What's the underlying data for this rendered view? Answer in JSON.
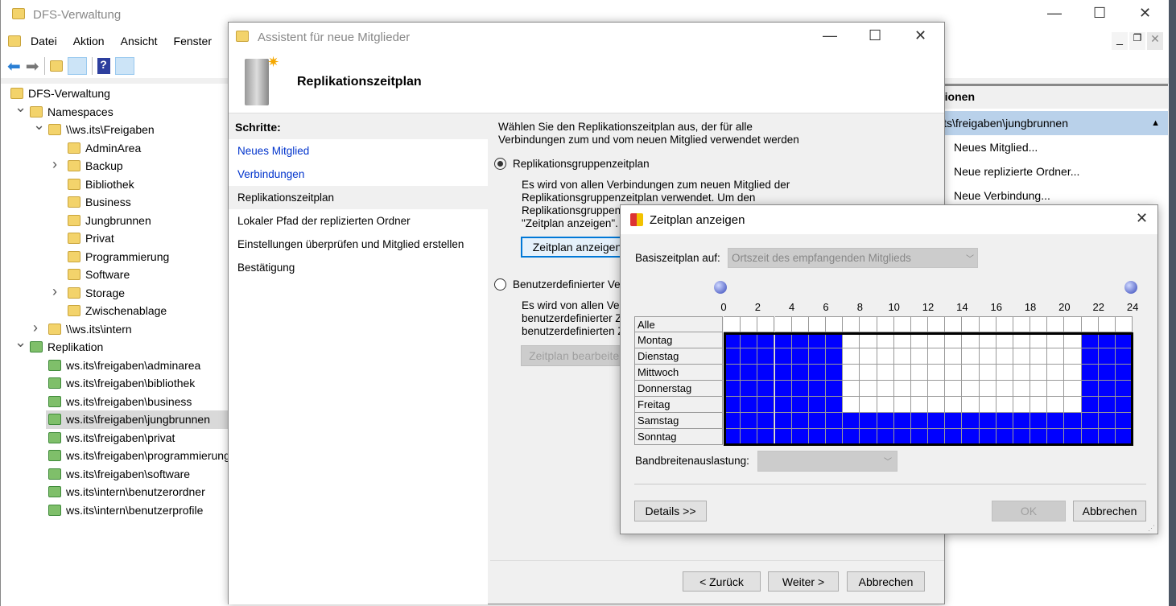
{
  "main_window": {
    "title": "DFS-Verwaltung",
    "menu": [
      "Datei",
      "Aktion",
      "Ansicht",
      "Fenster"
    ],
    "toolbar_icons": [
      "back-arrow-icon",
      "forward-arrow-icon",
      "up-folder-icon",
      "show-hide-tree-icon",
      "help-icon",
      "show-hide-action-icon"
    ]
  },
  "tree": [
    {
      "label": "DFS-Verwaltung",
      "level": 0,
      "icon": "dfs"
    },
    {
      "label": "Namespaces",
      "level": 1,
      "icon": "ns",
      "exp": "v"
    },
    {
      "label": "\\\\ws.its\\Freigaben",
      "level": 2,
      "icon": "ns",
      "exp": "v"
    },
    {
      "label": "AdminArea",
      "level": 3,
      "icon": "link"
    },
    {
      "label": "Backup",
      "level": 3,
      "icon": "folder",
      "exp": ">"
    },
    {
      "label": "Bibliothek",
      "level": 3,
      "icon": "link"
    },
    {
      "label": "Business",
      "level": 3,
      "icon": "link"
    },
    {
      "label": "Jungbrunnen",
      "level": 3,
      "icon": "link"
    },
    {
      "label": "Privat",
      "level": 3,
      "icon": "link"
    },
    {
      "label": "Programmierung",
      "level": 3,
      "icon": "link"
    },
    {
      "label": "Software",
      "level": 3,
      "icon": "link"
    },
    {
      "label": "Storage",
      "level": 3,
      "icon": "folder",
      "exp": ">"
    },
    {
      "label": "Zwischenablage",
      "level": 3,
      "icon": "link"
    },
    {
      "label": "\\\\ws.its\\intern",
      "level": 2,
      "icon": "ns",
      "exp": ">"
    },
    {
      "label": "Replikation",
      "level": 1,
      "icon": "rep",
      "exp": "v"
    },
    {
      "label": "ws.its\\freigaben\\adminarea",
      "level": 2,
      "icon": "rep"
    },
    {
      "label": "ws.its\\freigaben\\bibliothek",
      "level": 2,
      "icon": "rep"
    },
    {
      "label": "ws.its\\freigaben\\business",
      "level": 2,
      "icon": "rep"
    },
    {
      "label": "ws.its\\freigaben\\jungbrunnen",
      "level": 2,
      "icon": "rep",
      "selected": true
    },
    {
      "label": "ws.its\\freigaben\\privat",
      "level": 2,
      "icon": "rep"
    },
    {
      "label": "ws.its\\freigaben\\programmierung",
      "level": 2,
      "icon": "rep"
    },
    {
      "label": "ws.its\\freigaben\\software",
      "level": 2,
      "icon": "rep"
    },
    {
      "label": "ws.its\\intern\\benutzerordner",
      "level": 2,
      "icon": "rep"
    },
    {
      "label": "ws.its\\intern\\benutzerprofile",
      "level": 2,
      "icon": "rep"
    }
  ],
  "actions": {
    "header": "tionen",
    "selected": "its\\freigaben\\jungbrunnen",
    "items": [
      "Neues Mitglied...",
      "Neue replizierte Ordner...",
      "Neue Verbindung..."
    ]
  },
  "wizard": {
    "title": "Assistent für neue Mitglieder",
    "heading": "Replikationszeitplan",
    "steps_header": "Schritte:",
    "steps": [
      {
        "label": "Neues Mitglied",
        "link": true
      },
      {
        "label": "Verbindungen",
        "link": true
      },
      {
        "label": "Replikationszeitplan",
        "current": true
      },
      {
        "label": "Lokaler Pfad der replizierten Ordner"
      },
      {
        "label": "Einstellungen überprüfen und Mitglied erstellen"
      },
      {
        "label": "Bestätigung"
      }
    ],
    "intro_line1": "Wählen Sie den Replikationszeitplan aus, der für alle",
    "intro_line2": "Verbindungen zum und vom neuen Mitglied verwendet werden",
    "radio1": "Replikationsgruppenzeitplan",
    "radio1_checked": true,
    "radio1_desc": [
      "Es wird von allen Verbindungen zum neuen Mitglied der",
      "Replikationsgruppenzeitplan verwendet. Um den",
      "Replikationsgruppenz",
      "\"Zeitplan anzeigen\"."
    ],
    "show_schedule": "Zeitplan anzeigen",
    "radio2": "Benutzerdefinierter Ve",
    "radio2_desc": [
      "Es wird von allen Ver",
      "benutzerdefinierter Ze",
      "benutzerdefinierten Z"
    ],
    "edit_schedule": "Zeitplan bearbeiten",
    "back": "< Zurück",
    "next": "Weiter >",
    "cancel": "Abbrechen"
  },
  "dialog": {
    "title": "Zeitplan anzeigen",
    "base_label": "Basiszeitplan auf:",
    "base_value": "Ortszeit des empfangenden Mitglieds",
    "hours": [
      "0",
      "2",
      "4",
      "6",
      "8",
      "10",
      "12",
      "14",
      "16",
      "18",
      "20",
      "22",
      "24"
    ],
    "all_label": "Alle",
    "days": [
      "Montag",
      "Dienstag",
      "Mittwoch",
      "Donnerstag",
      "Freitag",
      "Samstag",
      "Sonntag"
    ],
    "schedule": [
      "111111100000000000000111",
      "111111100000000000000111",
      "111111100000000000000111",
      "111111100000000000000111",
      "111111100000000000000111",
      "111111111111111111111111",
      "111111111111111111111111"
    ],
    "bandwidth_label": "Bandbreitenauslastung:",
    "bandwidth_value": "",
    "details": "Details >>",
    "ok": "OK",
    "cancel": "Abbrechen",
    "colors": {
      "replication": "#0000ff",
      "no_replication": "#ffffff"
    }
  }
}
